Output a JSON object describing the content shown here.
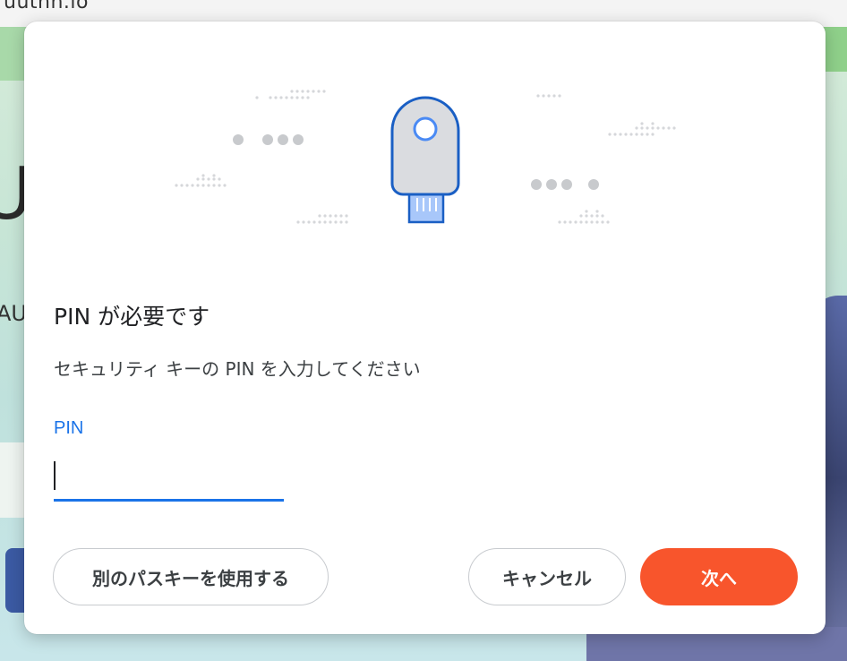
{
  "browser": {
    "url_fragment": "uuthn.io"
  },
  "background": {
    "partial_letter": "U",
    "partial_text": "AU"
  },
  "dialog": {
    "title": "PIN が必要です",
    "description": "セキュリティ キーの PIN を入力してください",
    "pin_label": "PIN",
    "pin_value": "",
    "illustration_icon": "security-key-icon",
    "buttons": {
      "use_other_passkey": "別のパスキーを使用する",
      "cancel": "キャンセル",
      "next": "次へ"
    }
  },
  "colors": {
    "accent": "#1a73e8",
    "primary_button": "#f8552c",
    "key_outline": "#1a5fc4",
    "key_body": "#dadce0"
  }
}
